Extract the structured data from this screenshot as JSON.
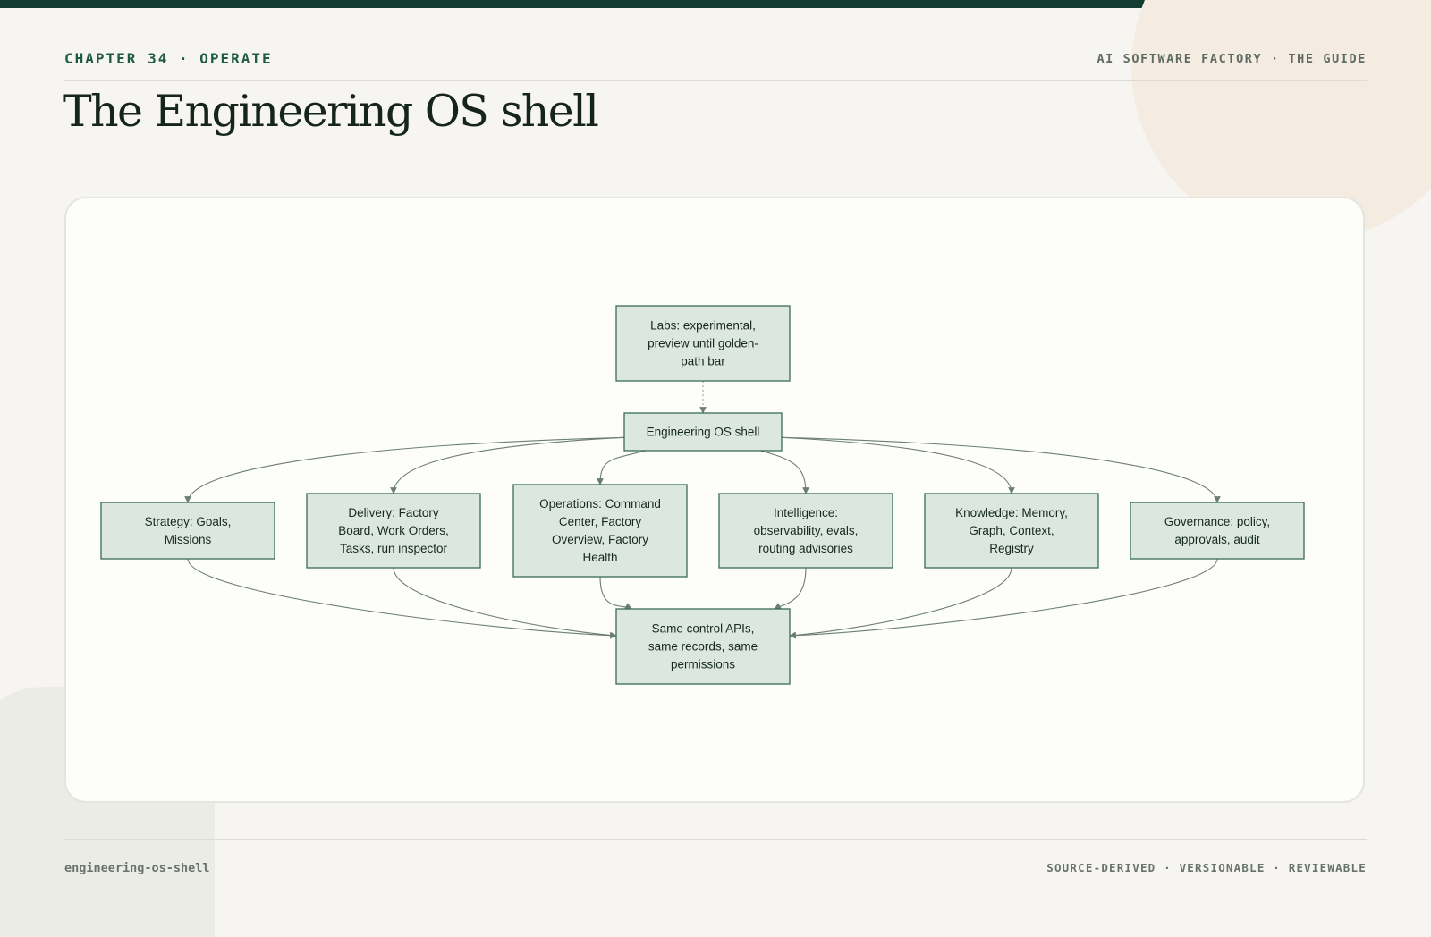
{
  "header": {
    "eyebrow": "CHAPTER 34 · OPERATE",
    "brand": "AI SOFTWARE FACTORY · THE GUIDE",
    "title": "The Engineering OS shell"
  },
  "diagram": {
    "nodes": [
      {
        "id": "labs",
        "lines": [
          "Labs: experimental,",
          "preview until golden-",
          "path bar"
        ]
      },
      {
        "id": "shell",
        "lines": [
          "Engineering OS shell"
        ]
      },
      {
        "id": "strategy",
        "lines": [
          "Strategy: Goals,",
          "Missions"
        ]
      },
      {
        "id": "delivery",
        "lines": [
          "Delivery: Factory",
          "Board, Work Orders,",
          "Tasks, run inspector"
        ]
      },
      {
        "id": "operations",
        "lines": [
          "Operations: Command",
          "Center, Factory",
          "Overview, Factory",
          "Health"
        ]
      },
      {
        "id": "intelligence",
        "lines": [
          "Intelligence:",
          "observability, evals,",
          "routing advisories"
        ]
      },
      {
        "id": "knowledge",
        "lines": [
          "Knowledge: Memory,",
          "Graph, Context,",
          "Registry"
        ]
      },
      {
        "id": "governance",
        "lines": [
          "Governance: policy,",
          "approvals, audit"
        ]
      },
      {
        "id": "control",
        "lines": [
          "Same control APIs,",
          "same records, same",
          "permissions"
        ]
      }
    ],
    "edges": [
      {
        "from": "labs",
        "to": "shell",
        "style": "dotted"
      },
      {
        "from": "shell",
        "to": "strategy",
        "style": "solid"
      },
      {
        "from": "shell",
        "to": "delivery",
        "style": "solid"
      },
      {
        "from": "shell",
        "to": "operations",
        "style": "solid"
      },
      {
        "from": "shell",
        "to": "intelligence",
        "style": "solid"
      },
      {
        "from": "shell",
        "to": "knowledge",
        "style": "solid"
      },
      {
        "from": "shell",
        "to": "governance",
        "style": "solid"
      },
      {
        "from": "strategy",
        "to": "control",
        "style": "solid"
      },
      {
        "from": "delivery",
        "to": "control",
        "style": "solid"
      },
      {
        "from": "operations",
        "to": "control",
        "style": "solid"
      },
      {
        "from": "intelligence",
        "to": "control",
        "style": "solid"
      },
      {
        "from": "knowledge",
        "to": "control",
        "style": "solid"
      },
      {
        "from": "governance",
        "to": "control",
        "style": "solid"
      }
    ]
  },
  "footer": {
    "slug": "engineering-os-shell",
    "tagline": "SOURCE-DERIVED · VERSIONABLE · REVIEWABLE"
  },
  "colors": {
    "accent": "#133d30",
    "node_fill": "#dce7e1",
    "node_border": "#3a6b58",
    "edge": "#6c7d74"
  }
}
